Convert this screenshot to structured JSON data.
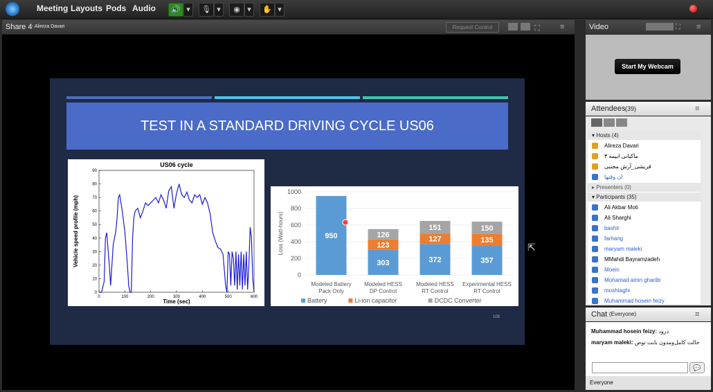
{
  "menu": {
    "items": [
      "Meeting",
      "Layouts",
      "Pods",
      "Audio"
    ]
  },
  "share": {
    "title": "Share 4",
    "presenter": "- Alireza Davari",
    "request_control": "Request Control"
  },
  "slide": {
    "title": "TEST IN A STANDARD DRIVING CYCLE US06",
    "page_number": "108"
  },
  "video": {
    "title": "Video",
    "start_webcam": "Start My Webcam"
  },
  "attendees": {
    "title": "Attendees",
    "count": "(39)",
    "hosts_label": "Hosts (4)",
    "hosts": [
      "Alireza Davari",
      "ماکیانی ابیمه ۳",
      "قریشی_آرش مجتبی",
      "ان وقتها"
    ],
    "presenters_label": "Presenters (0)",
    "participants_label": "Participants (35)",
    "participants": [
      "Ali Akbar Moti",
      "Ali Sharghi",
      "bashir",
      "farhang",
      "maryam maleki",
      "MMahdi Bayramzadeh",
      "Moein",
      "Mohamad amin gharibi",
      "moshtaghi",
      "Muhammad hosein feizy"
    ]
  },
  "chat": {
    "title": "Chat",
    "scope": "(Everyone)",
    "messages": [
      {
        "sender": "Muhammad hosein feizy:",
        "text": "درود"
      },
      {
        "sender": "maryam maleki:",
        "text": "حالت کامل‌ومدون بابت توص"
      }
    ],
    "recipient": "Everyone"
  },
  "chart_data": [
    {
      "type": "line",
      "title": "US06 cycle",
      "xlabel": "Time (sec)",
      "ylabel": "Vehicle speed profile (mph)",
      "xlim": [
        0,
        600
      ],
      "ylim": [
        0,
        90
      ],
      "xticks": [
        "0",
        "100",
        "200",
        "300",
        "400",
        "500",
        "600"
      ],
      "yticks": [
        "0",
        "10",
        "20",
        "30",
        "40",
        "50",
        "60",
        "70",
        "80",
        "90"
      ],
      "series": [
        {
          "x": [
            0,
            10,
            20,
            25,
            30,
            40,
            45,
            55,
            65,
            70,
            75,
            80,
            90,
            100,
            110,
            115,
            120,
            125,
            130,
            135,
            140,
            150,
            160,
            170,
            180,
            190,
            200,
            210,
            220,
            230,
            240,
            250,
            260,
            270,
            280,
            290,
            300,
            310,
            320,
            330,
            340,
            350,
            360,
            370,
            380,
            390,
            400,
            410,
            420,
            430,
            440,
            450,
            460,
            470,
            480,
            490,
            495,
            500,
            505,
            510,
            515,
            520,
            525,
            530,
            535,
            540,
            545,
            550,
            555,
            560,
            565,
            570,
            575,
            580,
            585,
            590,
            595,
            600
          ],
          "y": [
            0,
            0,
            8,
            40,
            44,
            20,
            5,
            35,
            45,
            55,
            70,
            72,
            60,
            45,
            20,
            5,
            0,
            0,
            40,
            55,
            60,
            62,
            55,
            60,
            66,
            64,
            66,
            68,
            70,
            66,
            72,
            68,
            62,
            75,
            78,
            62,
            73,
            80,
            72,
            70,
            74,
            68,
            66,
            72,
            70,
            72,
            65,
            70,
            66,
            58,
            44,
            38,
            33,
            32,
            28,
            5,
            0,
            30,
            28,
            5,
            30,
            25,
            5,
            30,
            2,
            28,
            5,
            30,
            2,
            28,
            5,
            30,
            2,
            20,
            48,
            40,
            10,
            0
          ]
        }
      ]
    },
    {
      "type": "bar",
      "ylabel": "Loss (Watt-hours)",
      "ylim": [
        0,
        1000
      ],
      "yticks": [
        "0",
        "200",
        "400",
        "600",
        "800",
        "1000"
      ],
      "categories": [
        "Modeled Battery Pack Only",
        "Modeled HESS DP Control",
        "Modeled HESS RT Control",
        "Experimental HESS RT Control"
      ],
      "series": [
        {
          "name": "Battery",
          "values": [
            950,
            303,
            372,
            357
          ],
          "color": "#5b9bd5"
        },
        {
          "name": "Li-ion capacitor",
          "values": [
            0,
            123,
            127,
            135
          ],
          "color": "#ed7d31"
        },
        {
          "name": "DCDC Converter",
          "values": [
            0,
            126,
            151,
            150
          ],
          "color": "#a5a5a5"
        }
      ],
      "stacked": true,
      "legend": "bottom"
    }
  ]
}
